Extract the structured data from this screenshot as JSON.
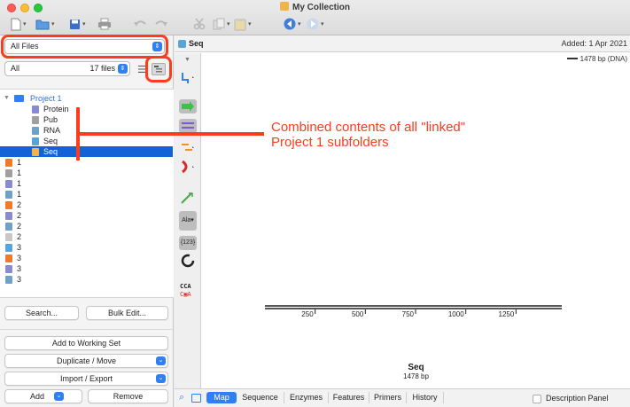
{
  "window": {
    "title": "My Collection"
  },
  "toolbar": {
    "new_icon": "new-document-icon",
    "open_icon": "folder-icon",
    "save_icon": "save-icon",
    "print_icon": "print-icon",
    "undo_icon": "undo-icon",
    "redo_icon": "redo-icon",
    "cut_icon": "cut-icon",
    "copy_icon": "copy-icon",
    "paste_icon": "paste-icon",
    "back_icon": "back-icon",
    "forward_icon": "forward-icon"
  },
  "sidebar": {
    "files_select": "All Files",
    "filter_value": "All",
    "filter_count": "17 files",
    "tree": [
      {
        "label": "Project 1",
        "kind": "folder",
        "indent": 0,
        "selected": false,
        "icon_color": "#2f7ff6"
      },
      {
        "label": "Protein",
        "kind": "protein",
        "indent": 1,
        "selected": false,
        "icon_color": "#8a8ad0"
      },
      {
        "label": "Pub",
        "kind": "pub",
        "indent": 1,
        "selected": false,
        "icon_color": "#a0a0a0"
      },
      {
        "label": "RNA",
        "kind": "rna",
        "indent": 1,
        "selected": false,
        "icon_color": "#6fa0c8"
      },
      {
        "label": "Seq",
        "kind": "seq",
        "indent": 1,
        "selected": false,
        "icon_color": "#58a4d8"
      },
      {
        "label": "Seq",
        "kind": "seq-doc",
        "indent": 1,
        "selected": true,
        "icon_color": "#f0b54a"
      },
      {
        "label": "1",
        "kind": "seq-doc",
        "indent": 0,
        "selected": false,
        "icon_color": "#f07a2a"
      },
      {
        "label": "1",
        "kind": "pub",
        "indent": 0,
        "selected": false,
        "icon_color": "#a0a0a0"
      },
      {
        "label": "1",
        "kind": "protein",
        "indent": 0,
        "selected": false,
        "icon_color": "#8a8ad0"
      },
      {
        "label": "1",
        "kind": "rna",
        "indent": 0,
        "selected": false,
        "icon_color": "#6fa0c8"
      },
      {
        "label": "2",
        "kind": "seq-doc",
        "indent": 0,
        "selected": false,
        "icon_color": "#f07a2a"
      },
      {
        "label": "2",
        "kind": "protein",
        "indent": 0,
        "selected": false,
        "icon_color": "#8a8ad0"
      },
      {
        "label": "2",
        "kind": "rna",
        "indent": 0,
        "selected": false,
        "icon_color": "#6fa0c8"
      },
      {
        "label": "2",
        "kind": "pub",
        "indent": 0,
        "selected": false,
        "icon_color": "#c8c8c8"
      },
      {
        "label": "3",
        "kind": "seq",
        "indent": 0,
        "selected": false,
        "icon_color": "#58a4d8"
      },
      {
        "label": "3",
        "kind": "seq-doc",
        "indent": 0,
        "selected": false,
        "icon_color": "#f07a2a"
      },
      {
        "label": "3",
        "kind": "protein",
        "indent": 0,
        "selected": false,
        "icon_color": "#8a8ad0"
      },
      {
        "label": "3",
        "kind": "rna",
        "indent": 0,
        "selected": false,
        "icon_color": "#6fa0c8"
      }
    ],
    "search_label": "Search...",
    "bulk_edit_label": "Bulk Edit...",
    "working_set_label": "Add to Working Set",
    "duplicate_label": "Duplicate / Move",
    "import_label": "Import / Export",
    "add_label": "Add",
    "remove_label": "Remove"
  },
  "document": {
    "title": "Seq",
    "added": "Added: 1 Apr 2021",
    "bp_info": "1478 bp  (DNA)",
    "seq_name": "Seq",
    "seq_length": "1478 bp",
    "ruler_ticks": [
      "250",
      "500",
      "750",
      "1000",
      "1250"
    ],
    "tools": [
      {
        "name": "restriction-sites-tool",
        "label": "cut"
      },
      {
        "name": "orf-tool",
        "label": "ORF"
      },
      {
        "name": "translate-tool",
        "label": "aa"
      },
      {
        "name": "align-tool",
        "label": "↔"
      },
      {
        "name": "mutation-tool",
        "label": "mut"
      },
      {
        "name": "primer-tool",
        "label": "primer"
      },
      {
        "name": "translation-tool",
        "label": "Ala"
      },
      {
        "name": "numbers-tool",
        "label": "{123}"
      },
      {
        "name": "circular-tool",
        "label": "circle"
      },
      {
        "name": "sequence-tool",
        "label": "CCA"
      }
    ]
  },
  "tabs": [
    {
      "label": "Map",
      "active": true
    },
    {
      "label": "Sequence",
      "active": false
    },
    {
      "label": "Enzymes",
      "active": false
    },
    {
      "label": "Features",
      "active": false
    },
    {
      "label": "Primers",
      "active": false
    },
    {
      "label": "History",
      "active": false
    }
  ],
  "description_panel_label": "Description Panel",
  "annotation": {
    "line1": "Combined contents of all \"linked\"",
    "line2": "Project 1 subfolders"
  },
  "colors": {
    "accent": "#2f7ff6",
    "annotation": "#ff3b1e",
    "selection": "#1463d6"
  }
}
